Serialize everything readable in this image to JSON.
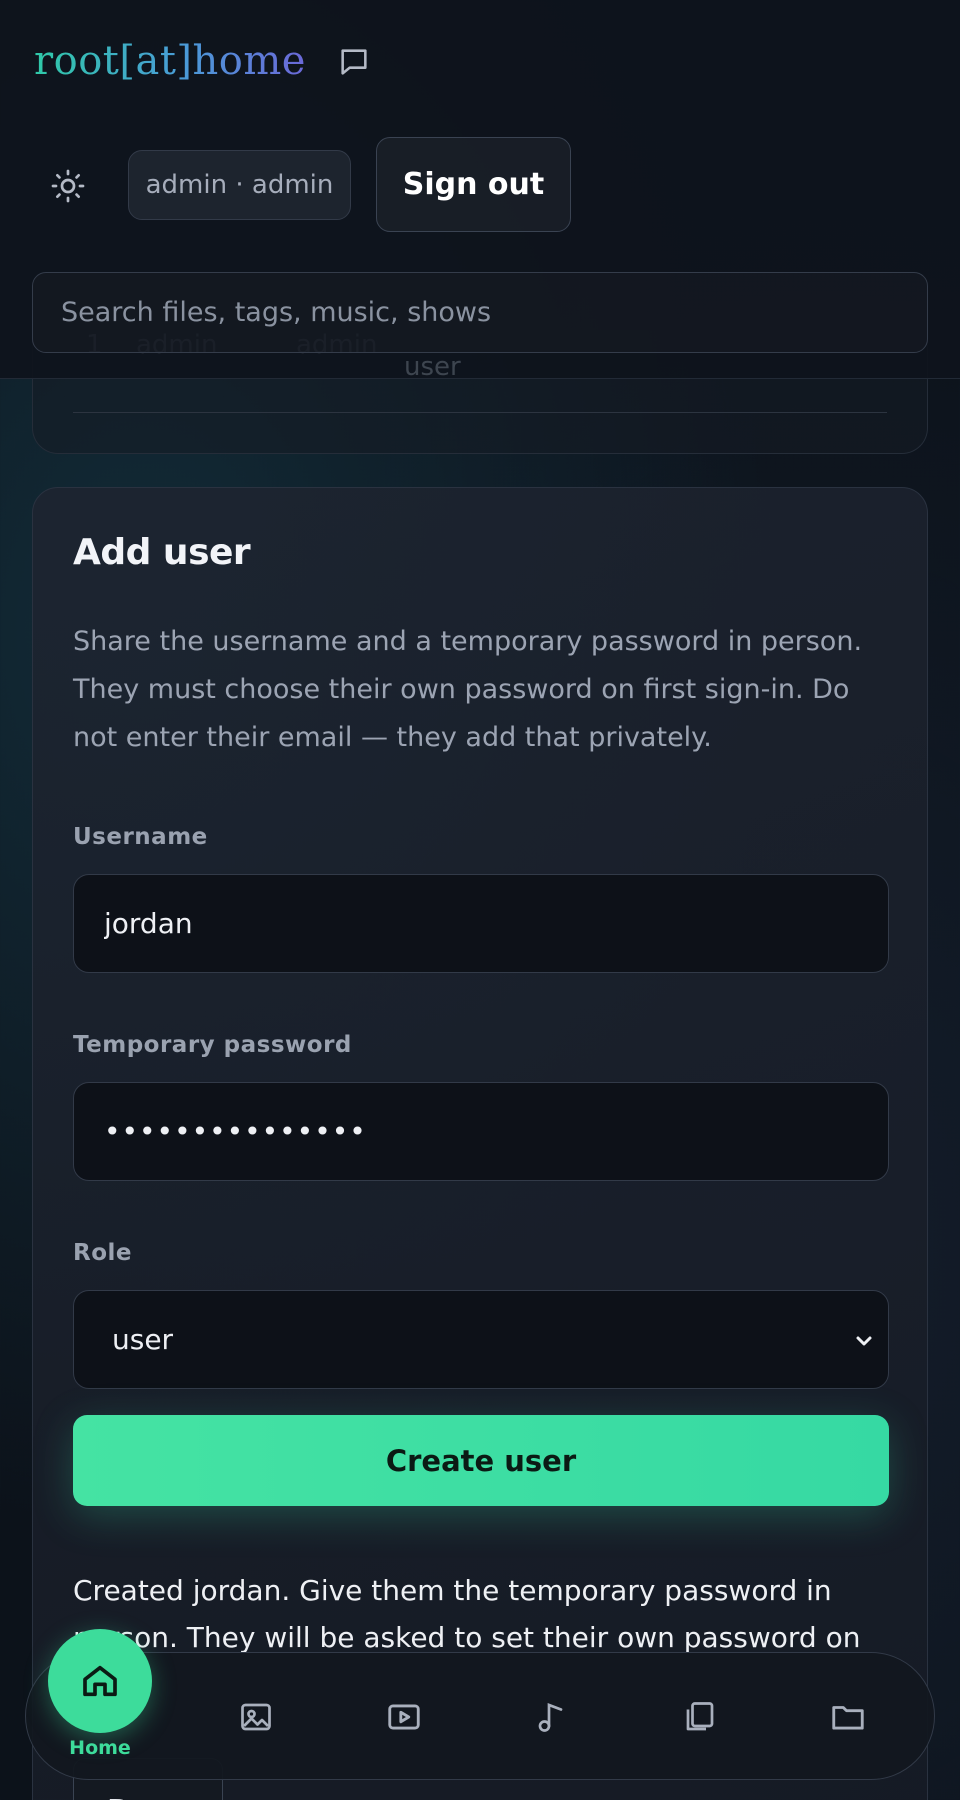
{
  "app": {
    "logo_text": "root[at]home"
  },
  "header": {
    "user_chip": "admin · admin",
    "signout_label": "Sign out",
    "search_placeholder": "Search files, tags, music, shows"
  },
  "users_table_row": {
    "id": "1",
    "username": "admin",
    "display": "admin",
    "role": "user"
  },
  "add_user": {
    "title": "Add user",
    "description": "Share the username and a temporary password in person. They must choose their own password on first sign-in. Do not enter their email — they add that privately.",
    "username_label": "Username",
    "username_value": "jordan",
    "password_label": "Temporary password",
    "password_value": "•••••••••••••••",
    "role_label": "Role",
    "role_value": "user",
    "create_label": "Create user",
    "result_message": "Created jordan. Give them the temporary password in person. They will be asked to set their own password on first",
    "done_label": "Done"
  },
  "bottom_nav": {
    "home_label": "Home",
    "items": [
      "home-icon",
      "image-icon",
      "video-icon",
      "music-icon",
      "copy-icon",
      "folder-icon"
    ]
  },
  "colors": {
    "accent": "#3ddc9b",
    "background": "#0c121a",
    "card": "#1c2230"
  }
}
